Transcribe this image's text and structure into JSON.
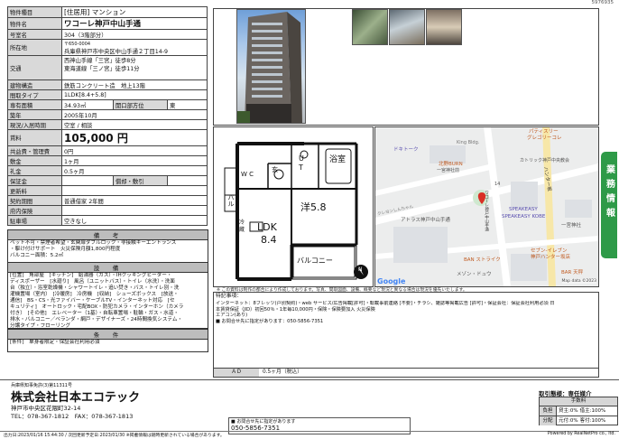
{
  "doc_id": "5976935",
  "spec": {
    "type_label": "物件種目",
    "type_value": "[住居用] マンション",
    "name_label": "物件名",
    "name_value": "ワコーレ神戸中山手通",
    "room_label": "号室名",
    "room_value": "304（3階部分）",
    "addr_label": "所在地",
    "addr_zip": "〒650-0004",
    "addr_value": "兵庫県神戸市中央区中山手通２丁目14-9",
    "traffic_label": "交通",
    "traffic_1": "西神山手線「三宮」徒歩8分",
    "traffic_2": "東海道線「三ノ宮」徒歩11分",
    "struct_label": "建物構造",
    "struct_value": "鉄筋コンクリート造　地上13階",
    "layout_label": "間取タイプ",
    "layout_value": "1LDK[8.4+5.8]",
    "area_label": "専有面積",
    "area_value": "34.93㎡",
    "dir_label": "開口部方位",
    "dir_value": "東",
    "built_label": "築年",
    "built_value": "2005年10月",
    "status_label": "現況/入居時期",
    "status_value": "空室 / 相談",
    "rent_label": "賃料",
    "rent_value": "105,000 円",
    "fee_label": "共益費・管理費",
    "fee_value": "0円",
    "deposit_label": "敷金",
    "deposit_value": "1ヶ月",
    "key_label": "礼金",
    "key_value": "0.5ヶ月",
    "guarantee_label": "保証金",
    "amort_label": "償却・敷引",
    "renew_label": "更新料",
    "contract_label": "契約期間",
    "contract_value": "普通借家 2年間",
    "insurance_label": "府内保険",
    "parking_label": "駐車場",
    "parking_value": "空きなし"
  },
  "remarks": {
    "title": "備　考",
    "line1": "ペット不可・禁煙者希望・玄関扉ダブルロック・非接触キーエントランス",
    "line2": "・駆け付けサポート　火災保険月額1,800円程度",
    "line3": "バルコニー面積：5.2㎡"
  },
  "facilities": {
    "title": "設　備",
    "lines": [
      "[位置]　角部屋　[キッチン]　給湯器（ガス）・IHクッキングヒーター・",
      "ディスポーザー　[水廻り]　風呂（ユニットバス）・トイレ（水洗）・洗面",
      "台（独立）・浴室乾燥機・シャワートイレ・追い焚き・バス・トイレ別・洗",
      "濯機置場（室内）　[冷暖房]　冷房機　[収納]　シューズボックス　[放送・",
      "通信]　BS・CS・光ファイバー・ケーブルTV・インターネット対応　[セ",
      "キュリティ]　オートロック・宅配BOX・防犯カメラ・インターホン（カメラ",
      "付き）　[その他]　エレベーター（1基）・自転車置場・駐輪・ガス・水道・",
      "排水・バルコニー／ベランダ・網戸・デザイナーズ・24時間換気システム・",
      "分譲タイプ・フローリング"
    ]
  },
  "conditions": {
    "title": "条　件",
    "line": "[条件]　単身者限定・保証会社利用必須"
  },
  "floorplan": {
    "ldk_label": "LDK",
    "ldk_size": "8.4",
    "western_label": "洋",
    "western_size": "5.8",
    "balcony_left": "バル",
    "balcony_bottom": "バルコニー",
    "wc_label": "W C",
    "genkan": "玄",
    "ut_u": "U",
    "ut_t": "T",
    "bath_label": "浴室",
    "fridge": "冷",
    "kura": "蔵",
    "compass": "N"
  },
  "map": {
    "labels": {
      "king": "King Bldg.",
      "dokito": "ドキトーク",
      "hokuto": "北野BURN",
      "ichinomiya": "一宮神社前",
      "crayon": "クレヨンしんちゃん",
      "patisserie": "パティスリー",
      "gregory": "グレゴリーコレ",
      "catholic": "カトリック神戸中央教会",
      "wacore": "ワコーレ神戸中山手通",
      "hunter": "ハンター坂",
      "athra": "アトラス神戸中山手通",
      "speakeasy1": "SPEAKEASY",
      "speakeasy2": "SPEAKEASY KOBE",
      "ichinomiya2": "一宮神社",
      "ban": "BAN ストライク",
      "seven1": "セブン-イレブン",
      "seven2": "神戸ハンター坂店",
      "bar": "BAR 天秤",
      "maison": "メゾン・ドュウ",
      "google": "Google",
      "copyright": "Map data ©2023",
      "num": "14"
    },
    "note": "※ この資料は制作の都合により作成しております。写真、間取図面、設備、概要など現況と異なる場合は現況を優先いたします。"
  },
  "special": {
    "title": "特記事項：",
    "line1": "インターネット：8フレッツ(戸別契約)・web サービス/広告掲載[許可]・転載事前連絡 [不要]・チラシ、雑誌等掲載広告 [許可]・保証会社：保証会社利用必須 日",
    "line2": "本賃貸保証（JID）初回50％・1年毎10,000円・保険・保険要加入 火災保険",
    "line3": "エアコン(あり)",
    "line4": "■ お問合せ先に指定があります：050-5856-7351"
  },
  "ad": {
    "label": "ＡＤ",
    "value": "0.5ヶ月（税込）"
  },
  "side_tab": "業務情報",
  "company": {
    "license": "兵庫県知事免許(3)第11311号",
    "name": "株式会社日本エコテック",
    "address": "神戸市中央区花隈町32-14",
    "tel": "TEL：078-367-1812",
    "fax": "FAX：078-367-1813"
  },
  "contact": {
    "label": "■ お問合せ先に指定があります",
    "number": "050-5856-7351"
  },
  "torihiki": {
    "title": "取引態様：専任媒介",
    "fee_label": "手数料",
    "row1_label": "負担",
    "row1_value": "貸主:0%",
    "row1_right": "借主:100%",
    "row2_label": "分配",
    "row2_value": "元付:0%",
    "row2_right": "客付:100%"
  },
  "footer": {
    "left": "出力日:2023/01/16 15:44:30 / 次回更新予定日:2023/01/30 ※掲載情報は随時更新されている場合があります。",
    "right": "Powered by RealNetPro co., ltd."
  },
  "colors": {
    "label_bg": "#d9d9d9",
    "tab_green": "#2e9a48",
    "pin_red": "#d93025"
  }
}
